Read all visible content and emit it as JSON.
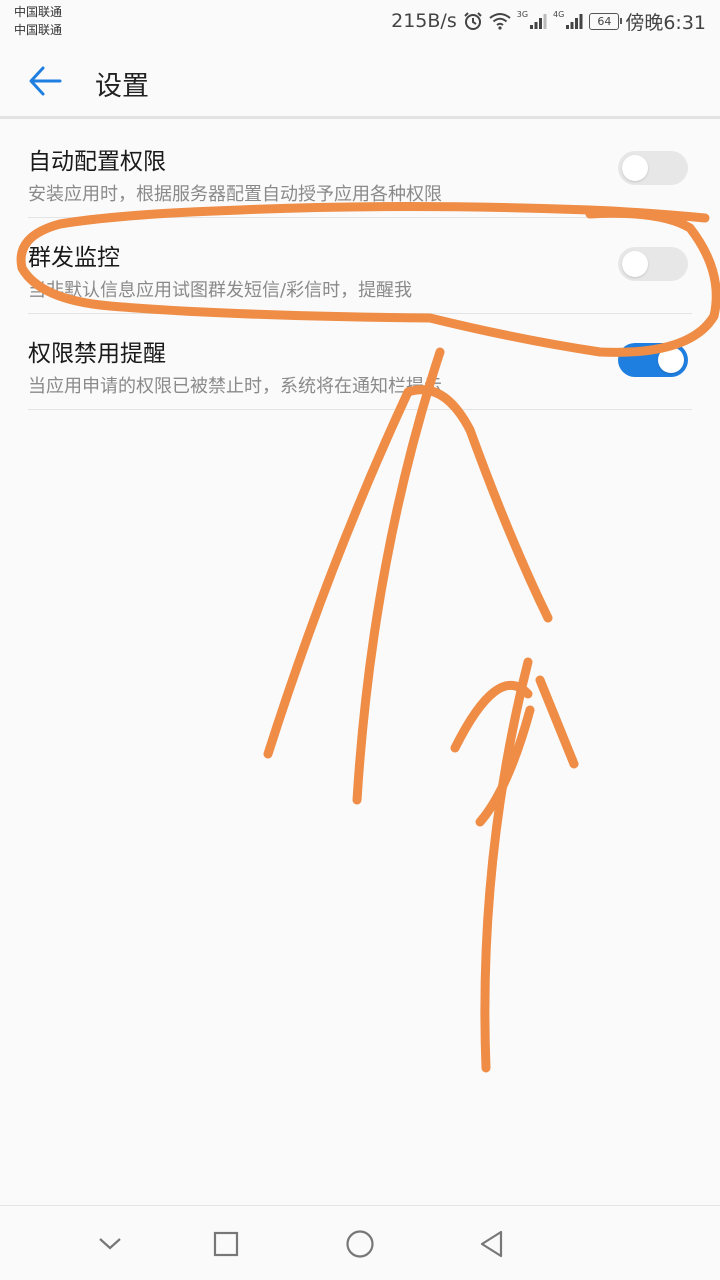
{
  "status_bar": {
    "carrier_1": "中国联通",
    "carrier_2": "中国联通",
    "net_speed": "215B/s",
    "net_3g": "3G",
    "net_4g": "4G",
    "battery": "64",
    "time": "傍晚6:31",
    "icons": [
      "alarm-icon",
      "wifi-icon",
      "signal-3g-icon",
      "signal-4g-icon",
      "battery-icon"
    ]
  },
  "header": {
    "title": "设置",
    "back_icon": "arrow-left-icon",
    "accent": "#1f7fe0"
  },
  "settings": [
    {
      "title": "自动配置权限",
      "subtitle": "安装应用时，根据服务器配置自动授予应用各种权限",
      "enabled": false
    },
    {
      "title": "群发监控",
      "subtitle": "当非默认信息应用试图群发短信/彩信时，提醒我",
      "enabled": false
    },
    {
      "title": "权限禁用提醒",
      "subtitle": "当应用申请的权限已被禁止时，系统将在通知栏提示",
      "enabled": true
    }
  ],
  "nav_bar": {
    "icons": [
      "chevron-down-icon",
      "recent-apps-icon",
      "home-icon",
      "back-triangle-icon"
    ]
  },
  "annotation": {
    "color": "#ef8c45",
    "shapes": [
      "circle-around-mass-monitoring",
      "arrow-up-1",
      "arrow-up-2"
    ]
  }
}
